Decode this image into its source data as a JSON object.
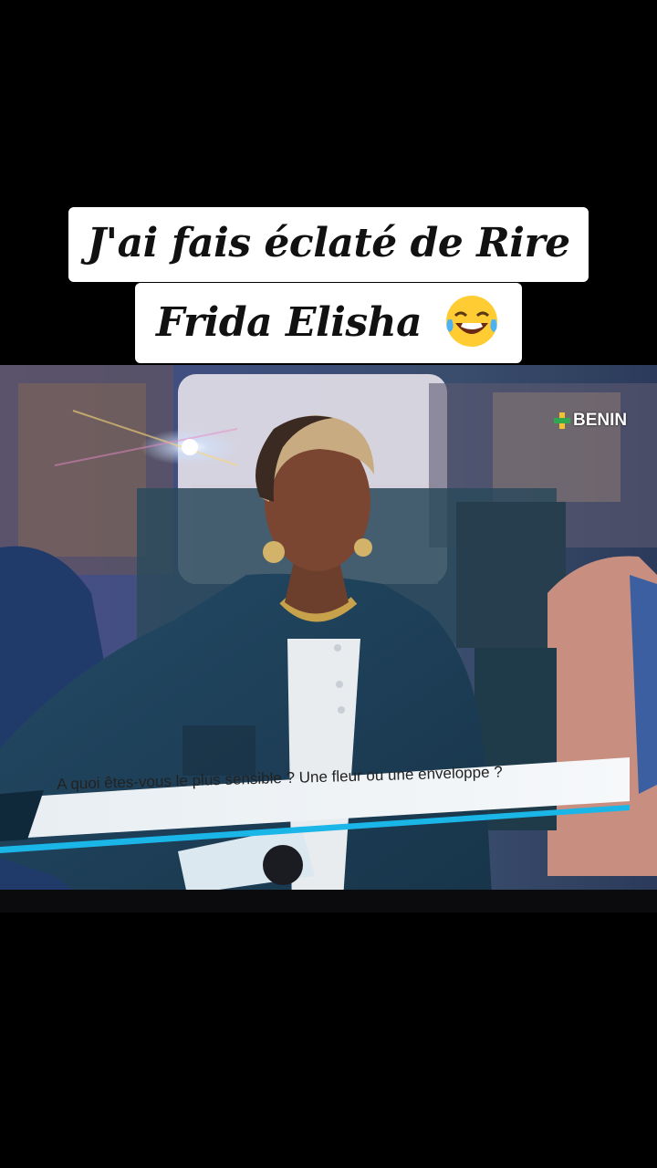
{
  "caption": {
    "line1": "J'ai fais éclaté de Rire",
    "line2": "Frida Elisha"
  },
  "emoji_icon": "face-with-tears-of-joy",
  "tv": {
    "channel_logo": "BENIN",
    "question": "A quoi êtes-vous le plus sensible ? Une fleur ou une enveloppe ?"
  },
  "colors": {
    "caption_bg": "#ffffff",
    "caption_text": "#111111",
    "lower_third_bg": "#eef3f6",
    "lower_third_accent": "#1bb6e8",
    "jacket": "#1e3d56",
    "logo_green": "#2fa84f"
  }
}
